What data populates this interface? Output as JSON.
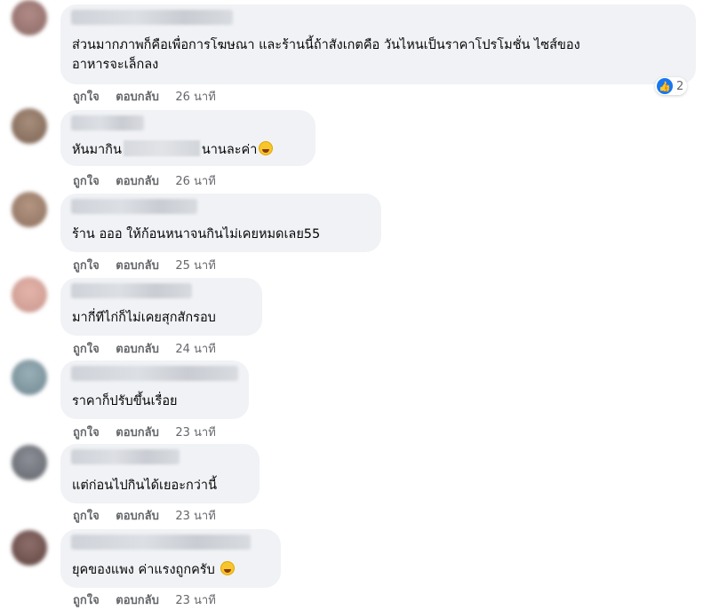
{
  "actions": {
    "like": "ถูกใจ",
    "reply": "ตอบกลับ"
  },
  "comments": [
    {
      "line1": "ส่วนมากภาพก็คือเพื่อการโฆษณา และร้านนี้ถ้าสังเกตคือ วันไหนเป็นราคาโปรโมชั่น ไซส์ของ",
      "line2": "อาหารจะเล็กลง",
      "time": "26 นาที",
      "reactions": "2"
    },
    {
      "pre": "หันมากิน",
      "post": "นานละค่า",
      "time": "26 นาที"
    },
    {
      "text": "ร้าน อออ ให้ก้อนหนาจนกินไม่เคยหมดเลย55",
      "time": "25 นาที"
    },
    {
      "text": "มากี่ทีไก่ก็ไม่เคยสุกสักรอบ",
      "time": "24 นาที"
    },
    {
      "text": "ราคาก็ปรับขึ้นเรื่อย",
      "time": "23 นาที"
    },
    {
      "text": "แต่ก่อนไปกินได้เยอะกว่านี้",
      "time": "23 นาที"
    },
    {
      "text": "ยุคของแพง ค่าแรงถูกครับ",
      "time": "23 นาที"
    }
  ],
  "icons": {
    "reaction": "like-icon",
    "emoji_laugh": "laughing-emoji-icon",
    "emoji_grin": "grinning-emoji-icon"
  },
  "colors": {
    "bubble": "#f0f2f5",
    "meta": "#65676b",
    "like": "#1877f2"
  }
}
